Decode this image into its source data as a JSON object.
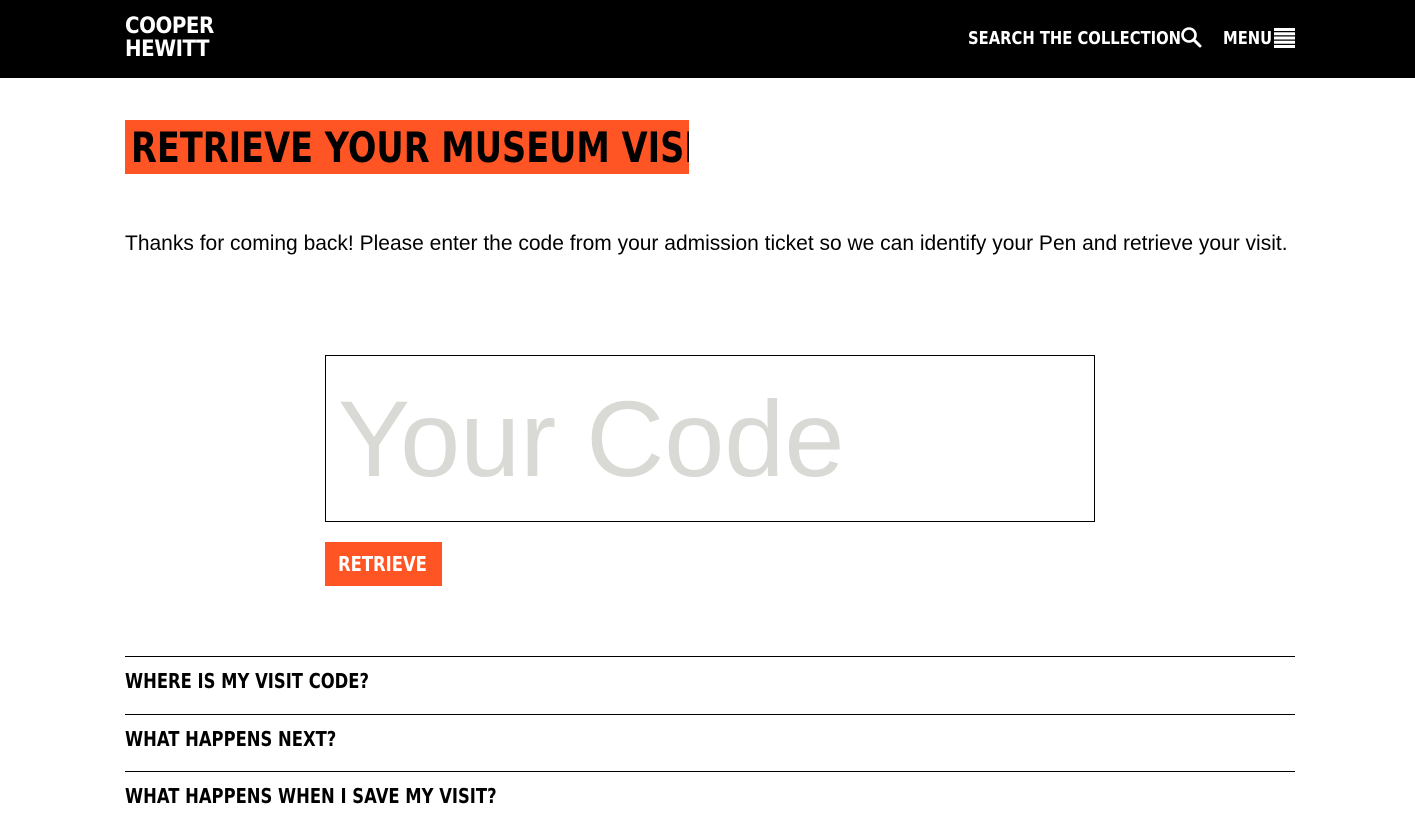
{
  "header": {
    "logo_line1": "COOPER",
    "logo_line2": "HEWITT",
    "search_label": "SEARCH THE COLLECTION",
    "search_icon": "search-icon",
    "menu_label": "MENU",
    "menu_icon": "menu-icon"
  },
  "main": {
    "title": "RETRIEVE YOUR MUSEUM VISIT",
    "intro": "Thanks for coming back! Please enter the code from your admission ticket so we can identify your Pen and retrieve your visit.",
    "code_input": {
      "placeholder": "Your Code",
      "value": ""
    },
    "retrieve_label": "RETRIEVE"
  },
  "faq": {
    "items": [
      {
        "label": "WHERE IS MY VISIT CODE?"
      },
      {
        "label": "WHAT HAPPENS NEXT?"
      },
      {
        "label": "WHAT HAPPENS WHEN I SAVE MY VISIT?"
      }
    ]
  },
  "colors": {
    "accent": "#ff5525",
    "header_bg": "#000000",
    "placeholder": "#d9d9d6"
  }
}
